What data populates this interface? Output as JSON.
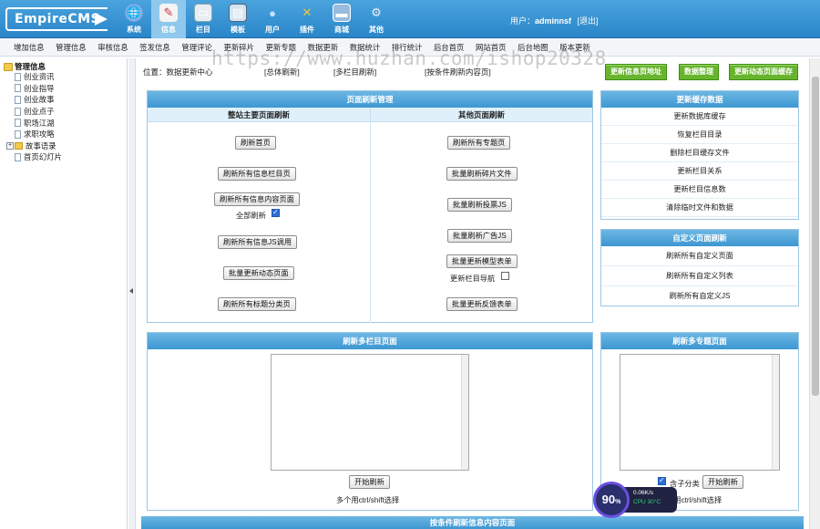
{
  "header": {
    "logo": "EmpireCMS",
    "nav": [
      {
        "label": "系统",
        "icon": "globe-icon"
      },
      {
        "label": "信息",
        "icon": "edit-icon",
        "active": true
      },
      {
        "label": "栏目",
        "icon": "folder-icon"
      },
      {
        "label": "模板",
        "icon": "template-icon"
      },
      {
        "label": "用户",
        "icon": "user-icon"
      },
      {
        "label": "插件",
        "icon": "plugin-icon"
      },
      {
        "label": "商城",
        "icon": "shop-icon"
      },
      {
        "label": "其他",
        "icon": "gear-icon"
      }
    ],
    "user_label": "用户：",
    "username": "adminnsf",
    "logout": "[退出]"
  },
  "submenu": [
    "增加信息",
    "管理信息",
    "审核信息",
    "签发信息",
    "管理评论",
    "更新碎片",
    "更新专题",
    "数据更新",
    "数据统计",
    "排行统计",
    "后台首页",
    "网站首页",
    "后台地图",
    "版本更新"
  ],
  "tree": {
    "root": "管理信息",
    "items": [
      "创业资讯",
      "创业指导",
      "创业故事",
      "创业点子",
      "职场江湖",
      "求职攻略",
      "故事语录",
      "首页幻灯片"
    ]
  },
  "location": {
    "text": "位置：数据更新中心",
    "links": [
      "[总体刷新]",
      "[多栏目刷新]",
      "[按条件刷新内容页]"
    ]
  },
  "top_buttons": [
    "更新信息页地址",
    "数据整理",
    "更新动态页面缓存"
  ],
  "refresh_panel": {
    "title": "页面刷新管理",
    "left_head": "整站主要页面刷新",
    "right_head": "其他页面刷新",
    "left_buttons": [
      "刷新首页",
      "刷新所有信息栏目页",
      "刷新所有信息内容页面",
      "刷新所有信息JS调用",
      "批量更新动态页面",
      "刷新所有标题分类页"
    ],
    "refresh_all_label": "全部刷新",
    "right_buttons": [
      "刷新所有专题页",
      "批量刷新碎片文件",
      "批量刷新投票JS",
      "批量刷新广告JS",
      "批量更新模型表单",
      "批量更新反馈表单"
    ],
    "update_nav_label": "更新栏目导航"
  },
  "cache_panel": {
    "title": "更新缓存数据",
    "items": [
      "更新数据库缓存",
      "恢复栏目目录",
      "删除栏目缓存文件",
      "更新栏目关系",
      "更新栏目信息数",
      "清除临时文件和数据"
    ]
  },
  "custom_panel": {
    "title": "自定义页面刷新",
    "items": [
      "刷新所有自定义页面",
      "刷新所有自定义列表",
      "刷新所有自定义JS"
    ]
  },
  "multi_column_panel": {
    "title": "刷新多栏目页面",
    "start": "开始刷新",
    "hint": "多个用ctrl/shift选择"
  },
  "multi_topic_panel": {
    "title": "刷新多专题页面",
    "include_sub": "含子分类",
    "start": "开始刷新",
    "hint": "多个用ctrl/shift选择"
  },
  "bottom_panel_title": "按条件刷新信息内容页面",
  "watermark": "https://www.huzhan.com/ishop20328",
  "speed_widget": {
    "percent": "90",
    "unit": "%",
    "upload": "0.06K/s",
    "cpu": "CPU 30°C"
  }
}
